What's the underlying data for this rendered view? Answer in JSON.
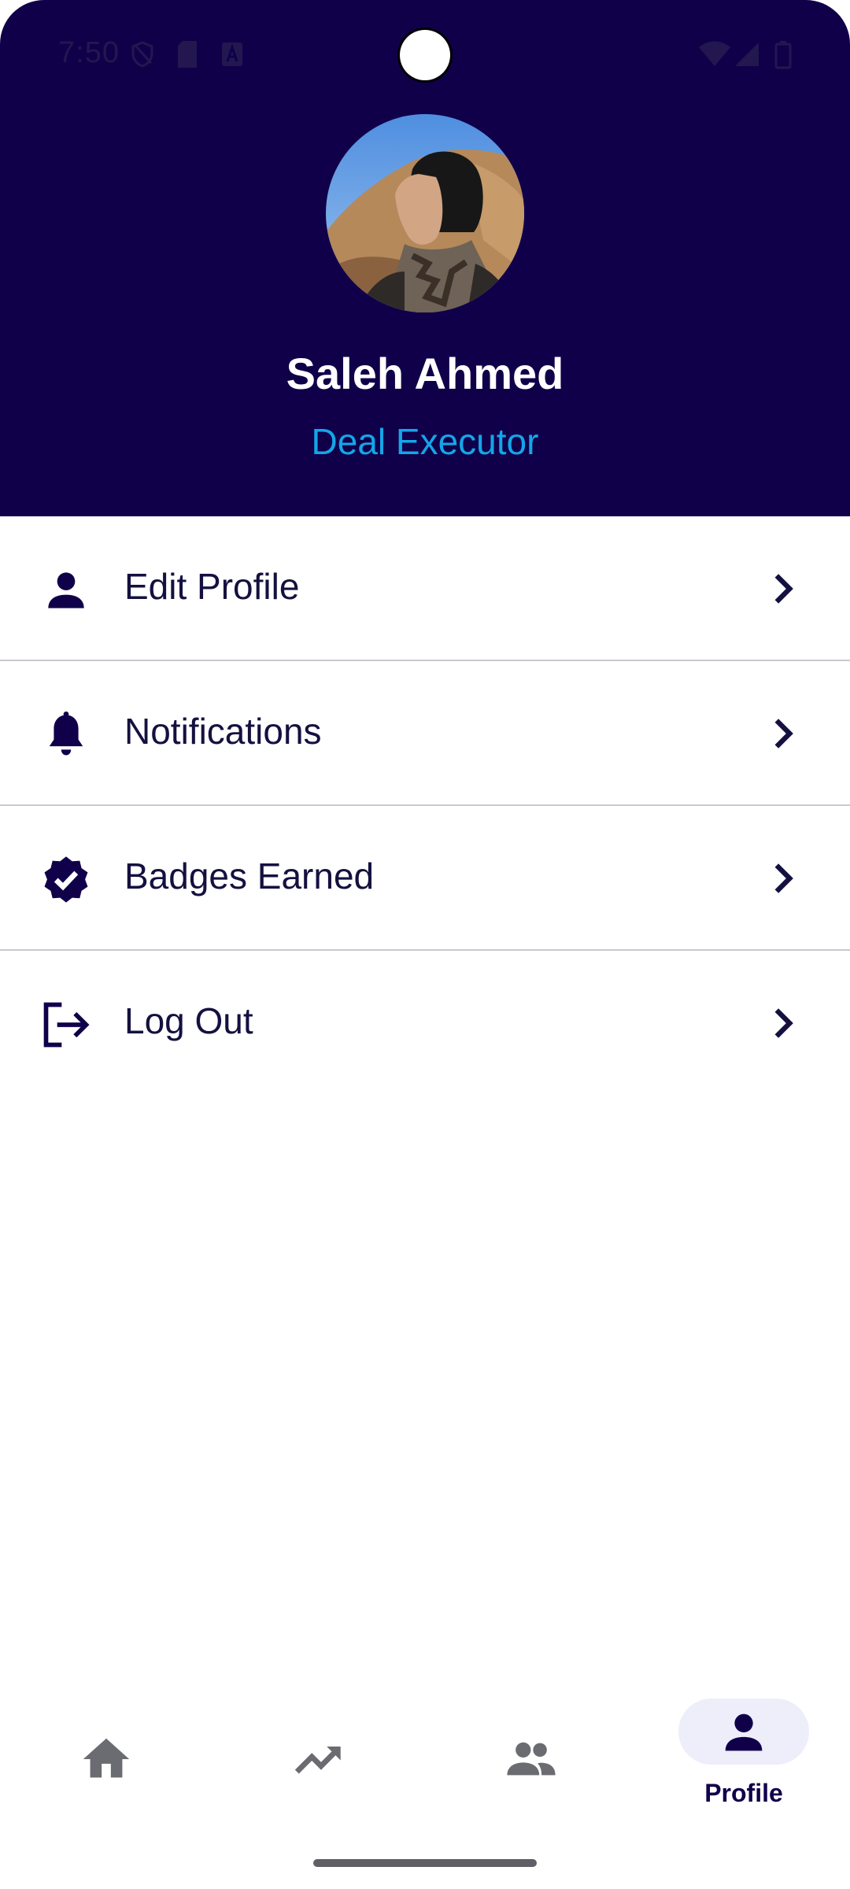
{
  "status_bar": {
    "time": "7:50",
    "icons": [
      "shield-icon",
      "sim-card-icon",
      "keyboard-icon",
      "wifi-icon",
      "signal-icon",
      "battery-icon"
    ]
  },
  "profile": {
    "name": "Saleh Ahmed",
    "role": "Deal Executor",
    "avatar": "profile-photo"
  },
  "menu": {
    "items": [
      {
        "label": "Edit Profile",
        "icon": "person-icon"
      },
      {
        "label": "Notifications",
        "icon": "bell-icon"
      },
      {
        "label": "Badges Earned",
        "icon": "verified-badge-icon"
      },
      {
        "label": "Log Out",
        "icon": "logout-icon"
      }
    ]
  },
  "bottom_nav": {
    "items": [
      {
        "label": "",
        "icon": "home-icon",
        "selected": false
      },
      {
        "label": "",
        "icon": "trending-up-icon",
        "selected": false
      },
      {
        "label": "",
        "icon": "group-icon",
        "selected": false
      },
      {
        "label": "Profile",
        "icon": "person-icon",
        "selected": true
      }
    ]
  },
  "colors": {
    "header_bg": "#10004a",
    "role_accent": "#14a6e8",
    "text_primary": "#141140",
    "nav_pill": "#eeedfa",
    "nav_inactive": "#6b6b72"
  }
}
